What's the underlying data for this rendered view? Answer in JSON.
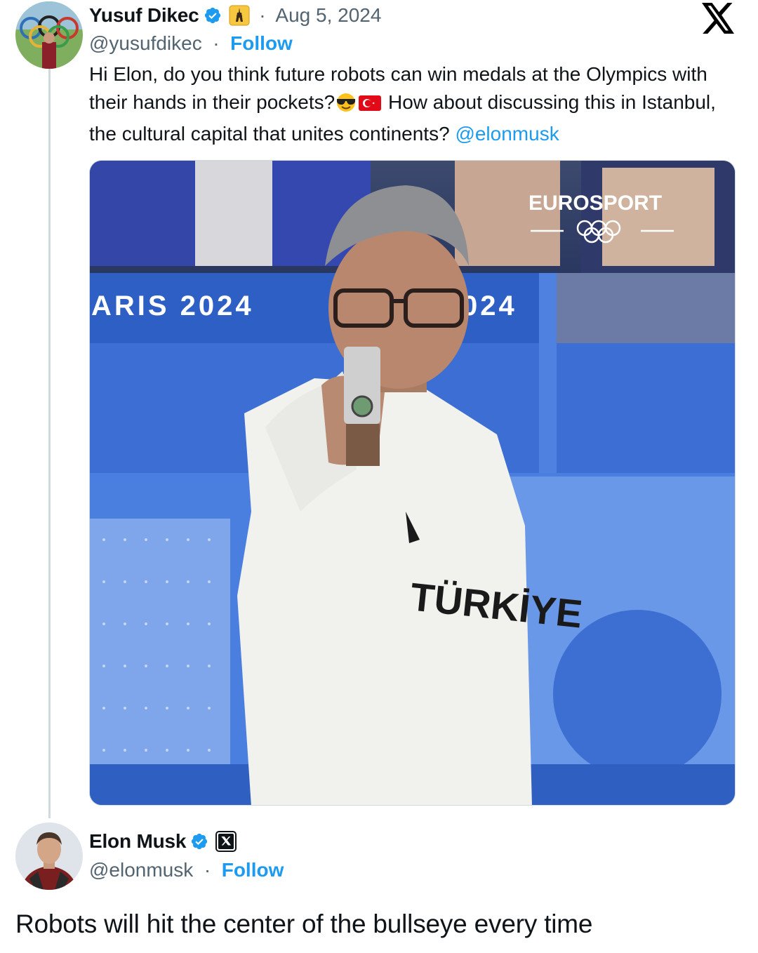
{
  "tweet": {
    "author": {
      "name": "Yusuf Dikec",
      "handle": "@yusufdikec",
      "verified": true,
      "affiliate_icon": "eiffel-tower-icon"
    },
    "separator": "·",
    "date": "Aug 5, 2024",
    "follow_label": "Follow",
    "text_part1": "Hi Elon, do you think future robots can win medals at the Olympics with their hands in their pockets?",
    "emojis": [
      "sunglasses-face-emoji",
      "turkey-flag-emoji"
    ],
    "text_part2": " How about discussing this in Istanbul, the cultural capital that unites continents? ",
    "mention": "@elonmusk",
    "media": {
      "broadcaster": "EUROSPORT",
      "banner_left": "ARIS 2024",
      "banner_right": "024",
      "shirt_text": "TÜRKİYE"
    }
  },
  "reply": {
    "author": {
      "name": "Elon Musk",
      "handle": "@elonmusk",
      "verified": true,
      "affiliate_icon": "x-logo-icon"
    },
    "separator": "·",
    "follow_label": "Follow",
    "text": "Robots will hit the center of the bullseye every time"
  },
  "platform_icon": "x-logo-icon",
  "colors": {
    "link": "#1d9bf0",
    "verified": "#1d9bf0",
    "secondary_text": "#536471",
    "primary_text": "#0f1419"
  }
}
